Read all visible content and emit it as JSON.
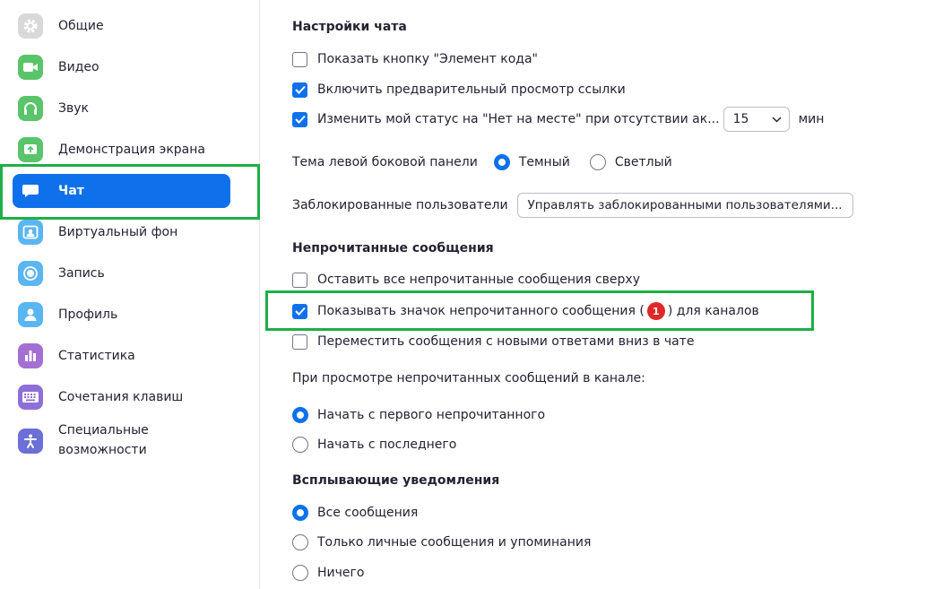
{
  "sidebar": {
    "items": [
      {
        "label": "Общие",
        "icon": "gear-icon",
        "color": "#d6d6d6"
      },
      {
        "label": "Видео",
        "icon": "video-camera-icon",
        "color": "#5ac46b"
      },
      {
        "label": "Звук",
        "icon": "headphones-icon",
        "color": "#5ac46b"
      },
      {
        "label": "Демонстрация экрана",
        "icon": "share-screen-icon",
        "color": "#5ac46b"
      },
      {
        "label": "Чат",
        "icon": "chat-bubble-icon",
        "color": "#0e71eb",
        "active": true
      },
      {
        "label": "Виртуальный фон",
        "icon": "virtual-background-icon",
        "color": "#5ab6f0"
      },
      {
        "label": "Запись",
        "icon": "record-icon",
        "color": "#5ab6f0"
      },
      {
        "label": "Профиль",
        "icon": "profile-icon",
        "color": "#5ab6f0"
      },
      {
        "label": "Статистика",
        "icon": "statistics-icon",
        "color": "#a46fd3"
      },
      {
        "label": "Сочетания клавиш",
        "icon": "keyboard-icon",
        "color": "#8d6fd8"
      },
      {
        "label": "Специальные\nвозможности",
        "icon": "accessibility-icon",
        "color": "#6b6fd6"
      }
    ]
  },
  "chat_settings": {
    "title": "Настройки чата",
    "show_code_snippet": {
      "label": "Показать кнопку \"Элемент кода\"",
      "checked": false
    },
    "link_preview": {
      "label": "Включить предварительный просмотр ссылки",
      "checked": true
    },
    "away_status": {
      "label": "Изменить мой статус на \"Нет на месте\" при отсутствии ак...",
      "checked": true,
      "minutes": "15",
      "unit": "мин"
    },
    "sidebar_theme": {
      "label": "Тема левой боковой панели",
      "dark": "Темный",
      "light": "Светлый",
      "selected": "dark"
    },
    "blocked_users": {
      "label": "Заблокированные пользователи",
      "button": "Управлять заблокированными пользователями..."
    }
  },
  "unread": {
    "title": "Непрочитанные сообщения",
    "keep_on_top": {
      "label": "Оставить все непрочитанные сообщения сверху",
      "checked": false
    },
    "show_badge": {
      "label_before": "Показывать значок непрочитанного сообщения (",
      "badge": "1",
      "label_after": ") для каналов",
      "checked": true
    },
    "move_replies": {
      "label": "Переместить сообщения с новыми ответами вниз в чате",
      "checked": false
    },
    "viewing_label": "При просмотре непрочитанных сообщений в канале:",
    "start_first": {
      "label": "Начать с первого непрочитанного",
      "selected": true
    },
    "start_last": {
      "label": "Начать с последнего",
      "selected": false
    }
  },
  "popups": {
    "title": "Всплывающие уведомления",
    "all": {
      "label": "Все сообщения",
      "selected": true
    },
    "private": {
      "label": "Только личные сообщения и упоминания",
      "selected": false
    },
    "none": {
      "label": "Ничего",
      "selected": false
    }
  },
  "colors": {
    "accent": "#0e71eb",
    "highlight": "#1fae48",
    "badge": "#e02828"
  }
}
